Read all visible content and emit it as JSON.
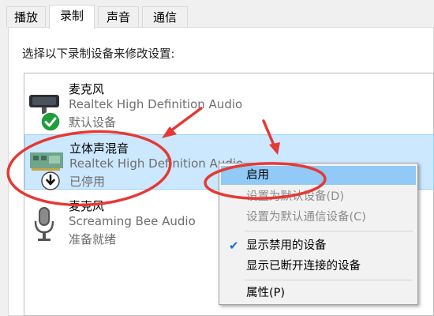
{
  "tabs": [
    {
      "label": "播放",
      "active": false
    },
    {
      "label": "录制",
      "active": true
    },
    {
      "label": "声音",
      "active": false
    },
    {
      "label": "通信",
      "active": false
    }
  ],
  "instruction": "选择以下录制设备来修改设置:",
  "devices": [
    {
      "name": "麦克风",
      "driver": "Realtek High Definition Audio",
      "status": "默认设备",
      "icon": "microphone-device-icon",
      "badge": "default-check-icon",
      "selected": false
    },
    {
      "name": "立体声混音",
      "driver": "Realtek High Definition Audio",
      "status": "已停用",
      "icon": "sound-card-icon",
      "badge": "disabled-arrow-icon",
      "selected": true
    },
    {
      "name": "麦克风",
      "driver": "Screaming Bee Audio",
      "status": "准备就绪",
      "icon": "microphone-icon",
      "badge": "",
      "selected": false
    }
  ],
  "context_menu": {
    "enable": "启用",
    "set_default": "设置为默认设备(D)",
    "set_default_comm": "设置为默认通信设备(C)",
    "show_disabled": "显示禁用的设备",
    "show_disconnected": "显示已断开连接的设备",
    "properties": "属性(P)"
  },
  "colors": {
    "selection": "#cce8ff",
    "menu_highlight": "#91c9f7",
    "annotation_red": "#e53935",
    "check_green": "#1e9e3a"
  }
}
